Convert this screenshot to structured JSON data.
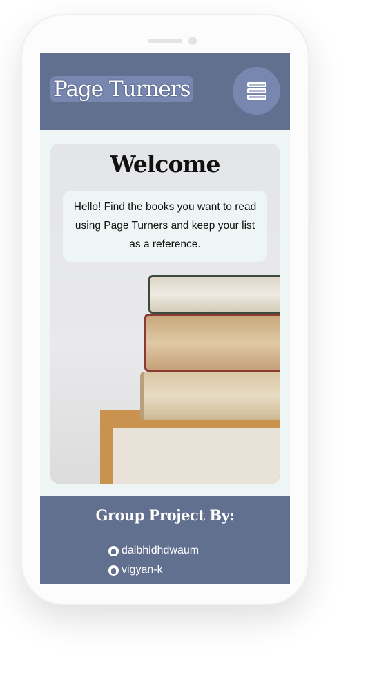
{
  "header": {
    "brand": "Page Turners",
    "menu_icon": "books-stack-icon"
  },
  "welcome": {
    "title": "Welcome",
    "text": "Hello! Find the books you want to read using Page Turners and keep your list as a reference."
  },
  "footer": {
    "title": "Group Project By:",
    "members": [
      {
        "name": "daibhidhdwaum",
        "icon": "github-icon"
      },
      {
        "name": "vigyan-k",
        "icon": "github-icon"
      }
    ]
  },
  "colors": {
    "header": "#62708f",
    "accent": "#7887b0",
    "background": "#eef6f5"
  }
}
